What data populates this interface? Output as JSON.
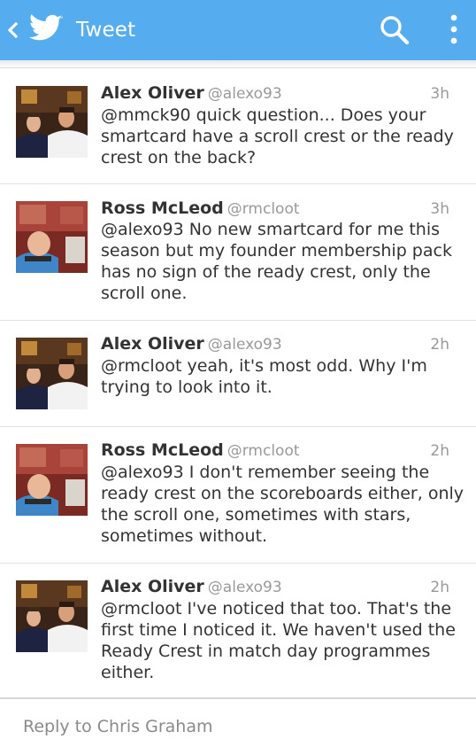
{
  "header": {
    "title": "Tweet",
    "back_icon": "chevron-left-icon",
    "logo_icon": "twitter-bird-icon",
    "search_icon": "search-icon",
    "menu_icon": "overflow-menu-icon",
    "bar_color": "#55acee"
  },
  "tweets": [
    {
      "name": "Alex Oliver",
      "handle": "@alexo93",
      "time": "3h",
      "text": "@mmck90 quick question... Does your smartcard have a scroll crest or the ready crest on the back?"
    },
    {
      "name": "Ross McLeod",
      "handle": "@rmcloot",
      "time": "3h",
      "text": "@alexo93 No new smartcard for me this season but my founder membership pack has no sign of the ready crest, only the scroll one."
    },
    {
      "name": "Alex Oliver",
      "handle": "@alexo93",
      "time": "2h",
      "text": "@rmcloot yeah, it's most odd. Why I'm trying to look into it."
    },
    {
      "name": "Ross McLeod",
      "handle": "@rmcloot",
      "time": "2h",
      "text": "@alexo93 I don't remember seeing the ready crest on the scoreboards either, only the scroll one, sometimes with stars, sometimes without."
    },
    {
      "name": "Alex Oliver",
      "handle": "@alexo93",
      "time": "2h",
      "text": "@rmcloot I've noticed that too. That's the first time I noticed it. We haven't used the Ready Crest in match day programmes either."
    }
  ],
  "reply": {
    "placeholder": "Reply to Chris Graham"
  }
}
